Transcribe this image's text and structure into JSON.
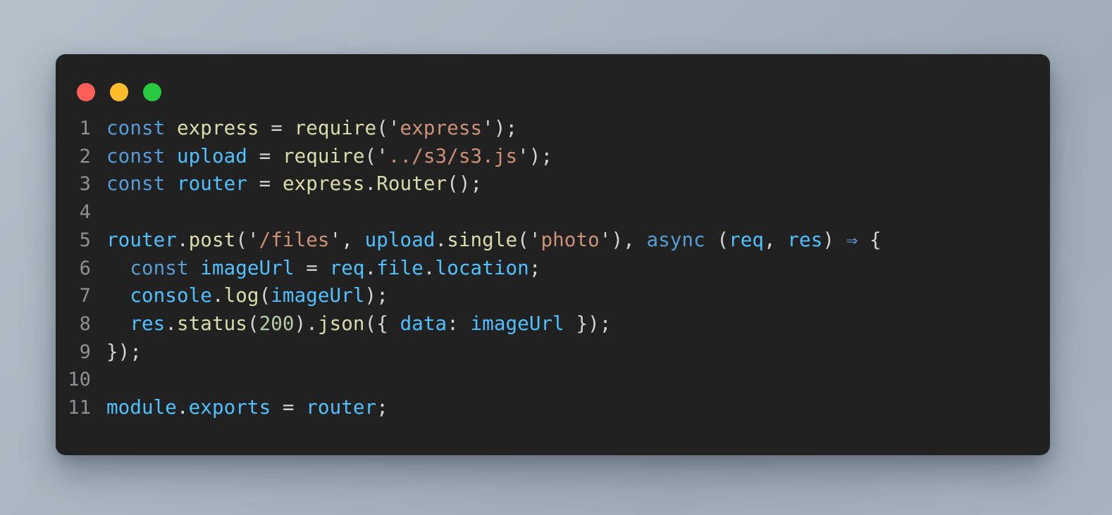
{
  "window": {
    "traffic_lights": [
      {
        "name": "close",
        "color": "#ff5f56"
      },
      {
        "name": "minimize",
        "color": "#ffbd2e"
      },
      {
        "name": "maximize",
        "color": "#27c93f"
      }
    ],
    "background_color": "#212121",
    "page_background_color": "#a9b5c0"
  },
  "editor": {
    "language": "javascript",
    "gutter_color": "#8e9296",
    "line_numbers": [
      "1",
      "2",
      "3",
      "4",
      "5",
      "6",
      "7",
      "8",
      "9",
      "10",
      "11"
    ],
    "plain_text": "const express = require('express');\nconst upload = require('../s3/s3.js');\nconst router = express.Router();\n\nrouter.post('/files', upload.single('photo'), async (req, res) => {\n  const imageUrl = req.file.location;\n  console.log(imageUrl);\n  res.status(200).json({ data: imageUrl });\n});\n\nmodule.exports = router;",
    "palette": {
      "keyword": "#569cd6",
      "variable": "#4fc1ff",
      "function": "#dcdcaa",
      "string": "#ce9178",
      "number": "#b5cea8",
      "punctuation": "#d4d4d4"
    },
    "lines": [
      {
        "number": "1",
        "tokens": [
          {
            "text": "const",
            "type": "keyword"
          },
          {
            "text": " ",
            "type": "punctuation"
          },
          {
            "text": "express",
            "type": "function"
          },
          {
            "text": " ",
            "type": "punctuation"
          },
          {
            "text": "=",
            "type": "punctuation"
          },
          {
            "text": " ",
            "type": "punctuation"
          },
          {
            "text": "require",
            "type": "function"
          },
          {
            "text": "(",
            "type": "punctuation"
          },
          {
            "text": "'",
            "type": "punctuation"
          },
          {
            "text": "express",
            "type": "string"
          },
          {
            "text": "'",
            "type": "punctuation"
          },
          {
            "text": ");",
            "type": "punctuation"
          }
        ]
      },
      {
        "number": "2",
        "tokens": [
          {
            "text": "const",
            "type": "keyword"
          },
          {
            "text": " ",
            "type": "punctuation"
          },
          {
            "text": "upload",
            "type": "variable"
          },
          {
            "text": " ",
            "type": "punctuation"
          },
          {
            "text": "=",
            "type": "punctuation"
          },
          {
            "text": " ",
            "type": "punctuation"
          },
          {
            "text": "require",
            "type": "function"
          },
          {
            "text": "(",
            "type": "punctuation"
          },
          {
            "text": "'",
            "type": "punctuation"
          },
          {
            "text": "../s3/s3.js",
            "type": "string"
          },
          {
            "text": "'",
            "type": "punctuation"
          },
          {
            "text": ");",
            "type": "punctuation"
          }
        ]
      },
      {
        "number": "3",
        "tokens": [
          {
            "text": "const",
            "type": "keyword"
          },
          {
            "text": " ",
            "type": "punctuation"
          },
          {
            "text": "router",
            "type": "variable"
          },
          {
            "text": " ",
            "type": "punctuation"
          },
          {
            "text": "=",
            "type": "punctuation"
          },
          {
            "text": " ",
            "type": "punctuation"
          },
          {
            "text": "express",
            "type": "function"
          },
          {
            "text": ".",
            "type": "punctuation"
          },
          {
            "text": "Router",
            "type": "function"
          },
          {
            "text": "();",
            "type": "punctuation"
          }
        ]
      },
      {
        "number": "4",
        "tokens": []
      },
      {
        "number": "5",
        "tokens": [
          {
            "text": "router",
            "type": "variable"
          },
          {
            "text": ".",
            "type": "punctuation"
          },
          {
            "text": "post",
            "type": "function"
          },
          {
            "text": "(",
            "type": "punctuation"
          },
          {
            "text": "'",
            "type": "punctuation"
          },
          {
            "text": "/files",
            "type": "string"
          },
          {
            "text": "'",
            "type": "punctuation"
          },
          {
            "text": ", ",
            "type": "punctuation"
          },
          {
            "text": "upload",
            "type": "variable"
          },
          {
            "text": ".",
            "type": "punctuation"
          },
          {
            "text": "single",
            "type": "function"
          },
          {
            "text": "(",
            "type": "punctuation"
          },
          {
            "text": "'",
            "type": "punctuation"
          },
          {
            "text": "photo",
            "type": "string"
          },
          {
            "text": "'",
            "type": "punctuation"
          },
          {
            "text": "), ",
            "type": "punctuation"
          },
          {
            "text": "async",
            "type": "keyword"
          },
          {
            "text": " (",
            "type": "punctuation"
          },
          {
            "text": "req",
            "type": "variable"
          },
          {
            "text": ", ",
            "type": "punctuation"
          },
          {
            "text": "res",
            "type": "variable"
          },
          {
            "text": ") ",
            "type": "punctuation"
          },
          {
            "text": "⇒",
            "type": "keyword"
          },
          {
            "text": " {",
            "type": "punctuation"
          }
        ]
      },
      {
        "number": "6",
        "tokens": [
          {
            "text": "  ",
            "type": "punctuation"
          },
          {
            "text": "const",
            "type": "keyword"
          },
          {
            "text": " ",
            "type": "punctuation"
          },
          {
            "text": "imageUrl",
            "type": "variable"
          },
          {
            "text": " ",
            "type": "punctuation"
          },
          {
            "text": "=",
            "type": "punctuation"
          },
          {
            "text": " ",
            "type": "punctuation"
          },
          {
            "text": "req",
            "type": "variable"
          },
          {
            "text": ".",
            "type": "punctuation"
          },
          {
            "text": "file",
            "type": "variable"
          },
          {
            "text": ".",
            "type": "punctuation"
          },
          {
            "text": "location",
            "type": "variable"
          },
          {
            "text": ";",
            "type": "punctuation"
          }
        ]
      },
      {
        "number": "7",
        "tokens": [
          {
            "text": "  ",
            "type": "punctuation"
          },
          {
            "text": "console",
            "type": "variable"
          },
          {
            "text": ".",
            "type": "punctuation"
          },
          {
            "text": "log",
            "type": "function"
          },
          {
            "text": "(",
            "type": "punctuation"
          },
          {
            "text": "imageUrl",
            "type": "variable"
          },
          {
            "text": ");",
            "type": "punctuation"
          }
        ]
      },
      {
        "number": "8",
        "tokens": [
          {
            "text": "  ",
            "type": "punctuation"
          },
          {
            "text": "res",
            "type": "variable"
          },
          {
            "text": ".",
            "type": "punctuation"
          },
          {
            "text": "status",
            "type": "function"
          },
          {
            "text": "(",
            "type": "punctuation"
          },
          {
            "text": "200",
            "type": "number"
          },
          {
            "text": ")",
            "type": "punctuation"
          },
          {
            "text": ".",
            "type": "punctuation"
          },
          {
            "text": "json",
            "type": "function"
          },
          {
            "text": "({ ",
            "type": "punctuation"
          },
          {
            "text": "data",
            "type": "variable"
          },
          {
            "text": ": ",
            "type": "punctuation"
          },
          {
            "text": "imageUrl",
            "type": "variable"
          },
          {
            "text": " });",
            "type": "punctuation"
          }
        ]
      },
      {
        "number": "9",
        "tokens": [
          {
            "text": "});",
            "type": "punctuation"
          }
        ]
      },
      {
        "number": "10",
        "tokens": []
      },
      {
        "number": "11",
        "tokens": [
          {
            "text": "module",
            "type": "variable"
          },
          {
            "text": ".",
            "type": "punctuation"
          },
          {
            "text": "exports",
            "type": "variable"
          },
          {
            "text": " ",
            "type": "punctuation"
          },
          {
            "text": "=",
            "type": "punctuation"
          },
          {
            "text": " ",
            "type": "punctuation"
          },
          {
            "text": "router",
            "type": "variable"
          },
          {
            "text": ";",
            "type": "punctuation"
          }
        ]
      }
    ]
  }
}
